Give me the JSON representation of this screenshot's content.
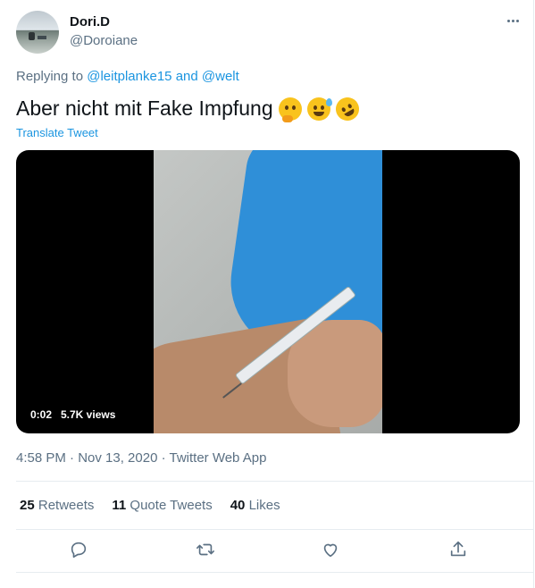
{
  "author": {
    "name": "Dori.D",
    "handle": "@Doroiane"
  },
  "reply": {
    "prefix": "Replying to",
    "user1": "@leitplanke15",
    "and": "and",
    "user2": "@welt"
  },
  "tweet": {
    "text": "Aber nicht mit Fake Impfung",
    "emojis": [
      "thinking-face-icon",
      "grinning-sweat-icon",
      "rofl-icon"
    ]
  },
  "translate_label": "Translate Tweet",
  "video": {
    "time": "0:02",
    "views": "5.7K views"
  },
  "meta": {
    "text": "4:58 PM · Nov 13, 2020 · Twitter Web App"
  },
  "stats": [
    {
      "count": "25",
      "label": "Retweets"
    },
    {
      "count": "11",
      "label": "Quote Tweets"
    },
    {
      "count": "40",
      "label": "Likes"
    }
  ],
  "colors": {
    "link": "#1b95e0",
    "muted": "#5b7083",
    "border": "#e6ecf0"
  }
}
